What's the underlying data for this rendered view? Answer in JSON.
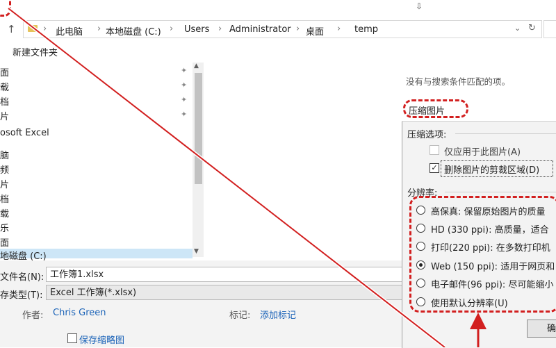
{
  "address": {
    "crumbs": [
      "此电脑",
      "本地磁盘 (C:)",
      "Users",
      "Administrator",
      "桌面",
      "temp"
    ],
    "separator": "›"
  },
  "toolbar": {
    "new_folder": "新建文件夹"
  },
  "nav": {
    "items": [
      "面",
      "载",
      "档",
      "片",
      "osoft Excel",
      "脑",
      "频",
      "片",
      "档",
      "载",
      "乐",
      "面",
      "地磁盘 (C:)"
    ]
  },
  "content": {
    "empty_message": "没有与搜索条件匹配的项。"
  },
  "form": {
    "filename_label": "文件名(N):",
    "filename_value": "工作簿1.xlsx",
    "type_label": "存类型(T):",
    "type_value": "Excel 工作簿(*.xlsx)",
    "author_label": "作者:",
    "author_value": "Chris Green",
    "tags_label": "标记:",
    "tags_value": "添加标记",
    "thumbnail_label": "保存缩略图"
  },
  "dialog": {
    "title": "压缩图片",
    "options_label": "压缩选项:",
    "apply_only": "仅应用于此图片(A)",
    "delete_crop": "删除图片的剪裁区域(D)",
    "resolution_label": "分辨率:",
    "resolutions": [
      "高保真: 保留原始图片的质量",
      "HD (330 ppi): 高质量，适合",
      "打印(220 ppi): 在多数打印机",
      "Web (150 ppi): 适用于网页和",
      "电子邮件(96 ppi): 尽可能缩小",
      "使用默认分辨率(U)"
    ],
    "selected_resolution": 3,
    "ok_label": "确"
  },
  "icons": {
    "up": "↑",
    "drop": "⌄",
    "refresh": "↻",
    "pin": "📌",
    "scroll_up": "▲",
    "scroll_down": "▼",
    "check": "✓"
  },
  "colors": {
    "annotation": "#d21f1f",
    "link": "#1b63b8",
    "selection": "#cde6f7"
  }
}
